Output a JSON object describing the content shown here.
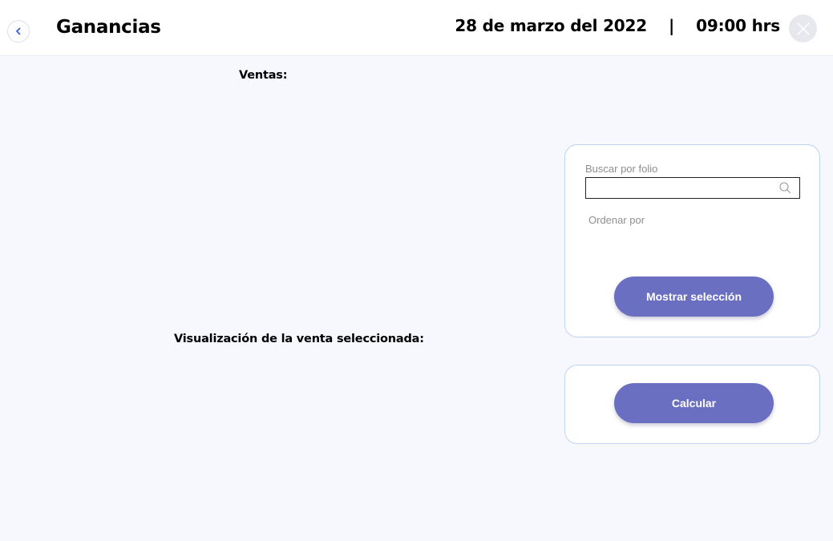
{
  "header": {
    "title": "Ganancias",
    "datetime": "28 de marzo del 2022    |    09:00 hrs"
  },
  "sections": {
    "ventas_label": "Ventas:",
    "visualization_label": "Visualización de la venta seleccionada:"
  },
  "filter_panel": {
    "search_label": "Buscar por folio",
    "search_value": "",
    "order_label": "Ordenar por",
    "show_selection_button": "Mostrar selección"
  },
  "calc_panel": {
    "calculate_button": "Calcular"
  },
  "icons": {
    "back": "chevron-left-icon",
    "close": "close-icon",
    "search": "search-icon"
  },
  "colors": {
    "accent": "#6b6fc1",
    "back_chevron": "#3b5bdb",
    "card_border": "#bcd3f2",
    "background": "#f6f8fd"
  }
}
